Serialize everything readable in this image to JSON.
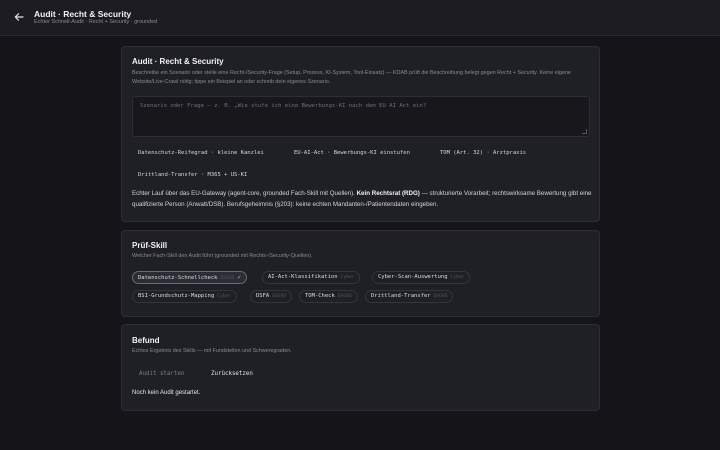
{
  "header": {
    "title": "Audit · Recht & Security",
    "subtitle": "Echter Schnell-Audit · Recht + Security · grounded"
  },
  "scenario": {
    "heading": "Audit · Recht & Security",
    "description": "Beschreibe ein Szenario oder stelle eine Recht-/Security-Frage (Setup, Prozess, KI-System, Tool-Einsatz) — KDAB prüft die Beschreibung belegt gegen Recht + Security. Keine eigene Website/Live-Crawl nötig; tippe ein Beispiel an oder schreib dein eigenes Szenario.",
    "placeholder": "Szenario oder Frage – z. B. „Wie stufe ich eine Bewerbungs-KI nach dem EU AI Act ein?",
    "examples": [
      "Datenschutz-Reifegrad · kleine Kanzlei",
      "EU-AI-Act · Bewerbungs-KI einstufen",
      "TOM (Art. 32) · Arztpraxis",
      "Drittland-Transfer · M365 + US-KI"
    ],
    "note_part1": "Echter Lauf über das EU-Gateway (agent-core, grounded Fach-Skill mit Quellen).",
    "note_bold": "Kein Rechtsrat (RDG)",
    "note_part2": "— strukturierte Vorarbeit; rechtswirksame Bewertung gibt eine qualifizierte Person (Anwalt/DSB). Berufsgeheimnis (§203): keine echten Mandanten-/Patientendaten eingeben."
  },
  "skill": {
    "heading": "Prüf-Skill",
    "description": "Welcher Fach-Skill den Audit führt (grounded mit Rechts-/Security-Quellen).",
    "options": [
      {
        "label": "Datenschutz-Schnellcheck",
        "tag": "DSGVO",
        "selected": true
      },
      {
        "label": "AI-Act-Klassifikation",
        "tag": "Cyber",
        "selected": false
      },
      {
        "label": "Cyber-Scan-Auswertung",
        "tag": "Cyber",
        "selected": false
      },
      {
        "label": "BSI-Grundschutz-Mapping",
        "tag": "Cyber",
        "selected": false
      },
      {
        "label": "DSFA",
        "tag": "DSGVO",
        "selected": false
      },
      {
        "label": "TOM-Check",
        "tag": "DSGVO",
        "selected": false
      },
      {
        "label": "Drittland-Transfer",
        "tag": "DSGVO",
        "selected": false
      }
    ],
    "check_glyph": "✓"
  },
  "result": {
    "heading": "Befund",
    "description": "Echtes Ergebnis des Skills — mit Fundstellen und Schweregraden.",
    "start_label": "Audit starten",
    "reset_label": "Zurücksetzen",
    "status": "Noch kein Audit gestartet."
  },
  "colors": {
    "background": "#141419",
    "card": "#1f1f26",
    "border": "#2d2d35",
    "text": "#e4e4e8",
    "muted": "#8a8a94"
  }
}
